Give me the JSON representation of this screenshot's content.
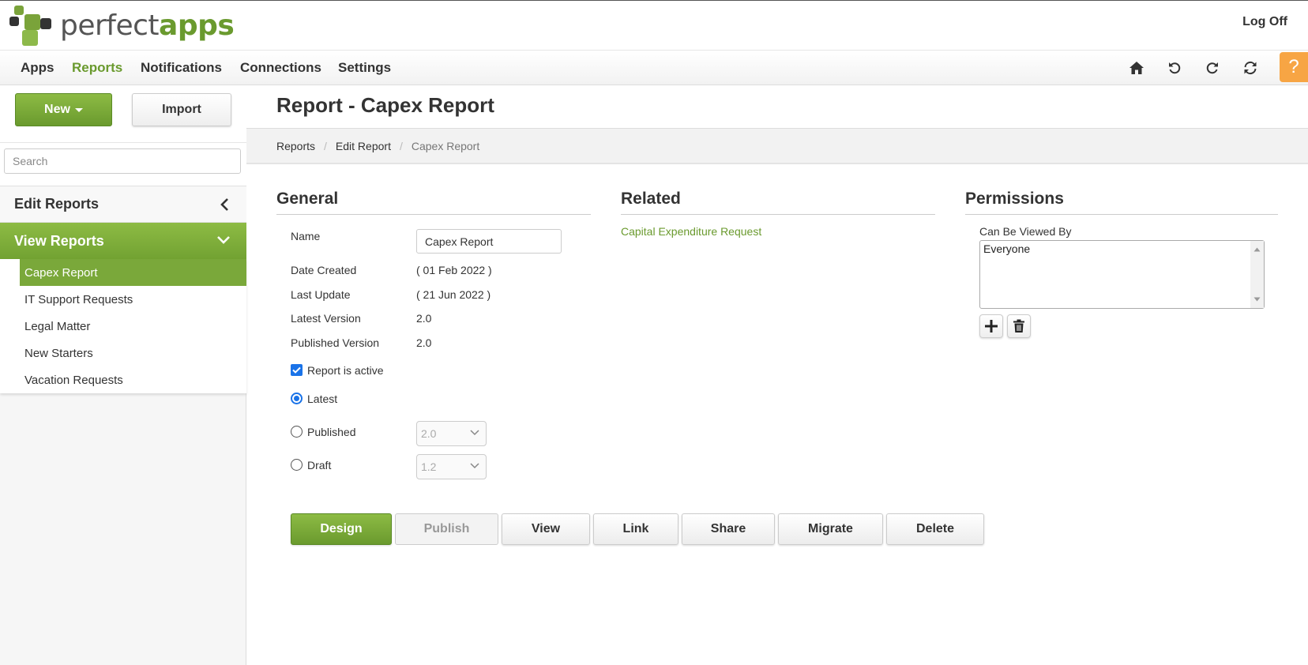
{
  "header": {
    "logo_light": "perfect",
    "logo_bold": "apps",
    "logoff_label": "Log Off"
  },
  "nav": {
    "items": [
      "Apps",
      "Reports",
      "Notifications",
      "Connections",
      "Settings"
    ],
    "active": "Reports",
    "icons": [
      "home-icon",
      "undo-icon",
      "redo-icon",
      "refresh-icon"
    ],
    "help_label": "?"
  },
  "sidebar": {
    "new_label": "New",
    "import_label": "Import",
    "search_placeholder": "Search",
    "edit_reports_label": "Edit Reports",
    "view_reports_label": "View Reports",
    "reports": [
      "Capex Report",
      "IT Support Requests",
      "Legal Matter",
      "New Starters",
      "Vacation Requests"
    ],
    "active_report": "Capex Report"
  },
  "main": {
    "title": "Report - Capex Report",
    "breadcrumb": [
      "Reports",
      "Edit Report",
      "Capex Report"
    ],
    "general": {
      "heading": "General",
      "name_label": "Name",
      "name_value": "Capex Report",
      "date_created_label": "Date Created",
      "date_created_value": "( 01 Feb 2022 )",
      "last_update_label": "Last Update",
      "last_update_value": "( 21 Jun 2022 )",
      "latest_version_label": "Latest Version",
      "latest_version_value": "2.0",
      "published_version_label": "Published Version",
      "published_version_value": "2.0",
      "active_label": "Report is active",
      "active_checked": true,
      "radio_latest_label": "Latest",
      "radio_published_label": "Published",
      "radio_draft_label": "Draft",
      "selected_radio": "Latest",
      "published_select_value": "2.0",
      "draft_select_value": "1.2"
    },
    "related": {
      "heading": "Related",
      "link": "Capital Expenditure Request"
    },
    "permissions": {
      "heading": "Permissions",
      "label": "Can Be Viewed By",
      "items": [
        "Everyone"
      ]
    },
    "actions": {
      "design": "Design",
      "publish": "Publish",
      "view": "View",
      "link": "Link",
      "share": "Share",
      "migrate": "Migrate",
      "delete": "Delete"
    }
  },
  "colors": {
    "brand_green": "#6a9a2e",
    "help_orange": "#f7a544",
    "checkbox_blue": "#1a73e8"
  }
}
